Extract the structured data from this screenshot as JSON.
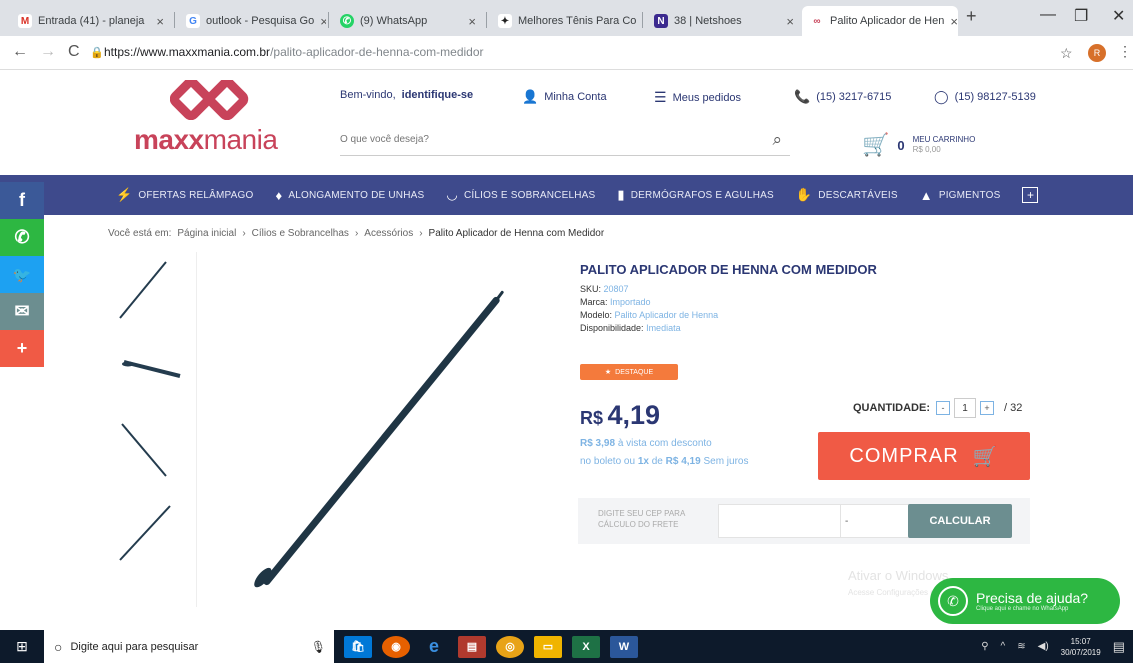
{
  "browser": {
    "tabs": [
      {
        "title": "Entrada (41) - planeja",
        "icon": "gmail-icon",
        "badge": "M",
        "color": "#d93025"
      },
      {
        "title": "outlook - Pesquisa Go",
        "icon": "google-icon",
        "badge": "G",
        "color": "#4285f4"
      },
      {
        "title": "(9) WhatsApp",
        "icon": "whatsapp-icon",
        "badge": "✆",
        "color": "#25d366"
      },
      {
        "title": "Melhores Tênis Para Co",
        "icon": "shoe-icon",
        "badge": "✦",
        "color": "#222"
      },
      {
        "title": "38 | Netshoes",
        "icon": "netshoes-icon",
        "badge": "N",
        "color": "#3c2a8f"
      },
      {
        "title": "Palito Aplicador de Hen",
        "icon": "maxxmania-icon",
        "badge": "∞",
        "color": "#c8435a"
      }
    ],
    "new_tab": "+",
    "url_host": "https://www.maxxmania.com.br",
    "url_path": "/palito-aplicador-de-henna-com-medidor",
    "profile_initial": "R"
  },
  "header": {
    "logo_text_bold": "maxx",
    "logo_text": "mania",
    "welcome_prefix": "Bem-vindo, ",
    "welcome_link": "identifique-se",
    "account": "Minha Conta",
    "orders": "Meus pedidos",
    "phone": "(15) 3217-6715",
    "whatsapp": "(15) 98127-5139",
    "search_placeholder": "O que você deseja?",
    "cart_count": "0",
    "cart_label": "MEU CARRINHO",
    "cart_total": "R$ 0,00"
  },
  "nav": [
    {
      "label": "OFERTAS RELÂMPAGO",
      "icon": "⚡"
    },
    {
      "label": "ALONGAMENTO DE UNHAS",
      "icon": "♦"
    },
    {
      "label": "CÍLIOS E SOBRANCELHAS",
      "icon": "◡"
    },
    {
      "label": "DERMÓGRAFOS E AGULHAS",
      "icon": "▮"
    },
    {
      "label": "DESCARTÁVEIS",
      "icon": "✋"
    },
    {
      "label": "PIGMENTOS",
      "icon": "▲"
    }
  ],
  "nav_more": "+",
  "social": [
    {
      "label": "f",
      "icon": "facebook-icon",
      "color": "#3b5998"
    },
    {
      "label": "✆",
      "icon": "whatsapp-icon",
      "color": "#2db742"
    },
    {
      "label": "🐦",
      "icon": "twitter-icon",
      "color": "#1da1f2"
    },
    {
      "label": "✉",
      "icon": "email-icon",
      "color": "#6c8e90"
    },
    {
      "label": "+",
      "icon": "plus-icon",
      "color": "#f05a45"
    }
  ],
  "breadcrumb": {
    "prefix": "Você está em:",
    "items": [
      "Página inicial",
      "Cílios e Sobrancelhas",
      "Acessórios"
    ],
    "current": "Palito Aplicador de Henna com Medidor",
    "separator": "›"
  },
  "product": {
    "title": "PALITO APLICADOR DE HENNA COM MEDIDOR",
    "sku_label": "SKU:",
    "sku": "20807",
    "brand_label": "Marca:",
    "brand": "Importado",
    "model_label": "Modelo:",
    "model": "Palito Aplicador de Henna",
    "availability_label": "Disponibilidade:",
    "availability": "Imediata",
    "badge": "DESTAQUE",
    "currency": "R$",
    "price": "4,19",
    "cash_price": "R$ 3,98",
    "cash_note": "à vista com desconto",
    "boleto_prefix": "no boleto  ou",
    "installments": "1x",
    "installment_prefix": "de",
    "installment_value": "R$ 4,19",
    "installment_suffix": "Sem juros",
    "qty_label": "QUANTIDADE:",
    "qty_value": "1",
    "qty_max": "/ 32",
    "buy_label": "COMPRAR",
    "shipping_label": "DIGITE SEU CEP PARA CÁLCULO DO FRETE",
    "shipping_sep": "-",
    "calc_label": "CALCULAR"
  },
  "windows_watermark": {
    "line1": "Ativar o Windows",
    "line2": "Acesse Configurações para ativar o Windows."
  },
  "help": {
    "title": "Precisa de ajuda?",
    "subtitle": "Clique aqui e chame no WhatsApp"
  },
  "taskbar": {
    "search_placeholder": "Digite aqui para pesquisar",
    "apps": [
      {
        "icon": "store-icon",
        "glyph": "🛍",
        "color": "#0078d7"
      },
      {
        "icon": "firefox-icon",
        "glyph": "◉",
        "color": "#e66000"
      },
      {
        "icon": "edge-icon",
        "glyph": "e",
        "color": "#0a66c2"
      },
      {
        "icon": "pdf-icon",
        "glyph": "▤",
        "color": "#b03a2e"
      },
      {
        "icon": "chrome-icon",
        "glyph": "◎",
        "color": "#e8a317"
      },
      {
        "icon": "files-icon",
        "glyph": "▭",
        "color": "#f0b400"
      },
      {
        "icon": "excel-icon",
        "glyph": "X",
        "color": "#1e7145"
      },
      {
        "icon": "word-icon",
        "glyph": "W",
        "color": "#2b579a"
      }
    ],
    "time": "15:07",
    "date": "30/07/2019"
  }
}
